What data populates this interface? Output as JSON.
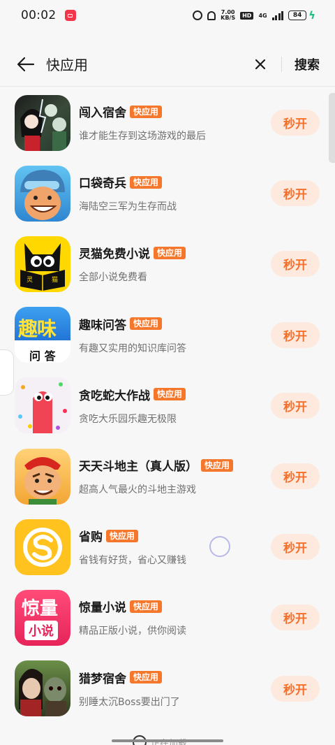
{
  "status_bar": {
    "time": "00:02",
    "speed_value": "7.00",
    "speed_unit": "KB/S",
    "hd_label": "HD",
    "network_label": "4G",
    "battery": "84"
  },
  "search": {
    "query": "快应用",
    "search_button": "搜索"
  },
  "badge_label": "快应用",
  "open_label": "秒开",
  "results": [
    {
      "name": "闯入宿舍",
      "desc": "谁才能生存到这场游戏的最后"
    },
    {
      "name": "口袋奇兵",
      "desc": "海陆空三军为生存而战"
    },
    {
      "name": "灵猫免费小说",
      "desc": "全部小说免费看"
    },
    {
      "name": "趣味问答",
      "desc": "有趣又实用的知识库问答"
    },
    {
      "name": "贪吃蛇大作战",
      "desc": "贪吃大乐园乐趣无极限"
    },
    {
      "name": "天天斗地主（真人版）",
      "desc": "超高人气最火的斗地主游戏"
    },
    {
      "name": "省购",
      "desc": "省钱有好货，省心又赚钱"
    },
    {
      "name": "惊量小说",
      "desc": "精品正版小说，供你阅读"
    },
    {
      "name": "猎梦宿舍",
      "desc": "别睡太沉Boss要出门了"
    }
  ],
  "icon_text": {
    "lingmao_left": "灵",
    "lingmao_right": "猫",
    "quwei_top": "趣味",
    "quwei_bottom": "问 答",
    "jingliang_top": "惊量",
    "jingliang_bottom": "小说"
  },
  "footer": {
    "loading_text": "正在加载"
  },
  "colors": {
    "accent": "#f5772c",
    "button_bg": "#fde9de",
    "button_text": "#f2702c"
  }
}
